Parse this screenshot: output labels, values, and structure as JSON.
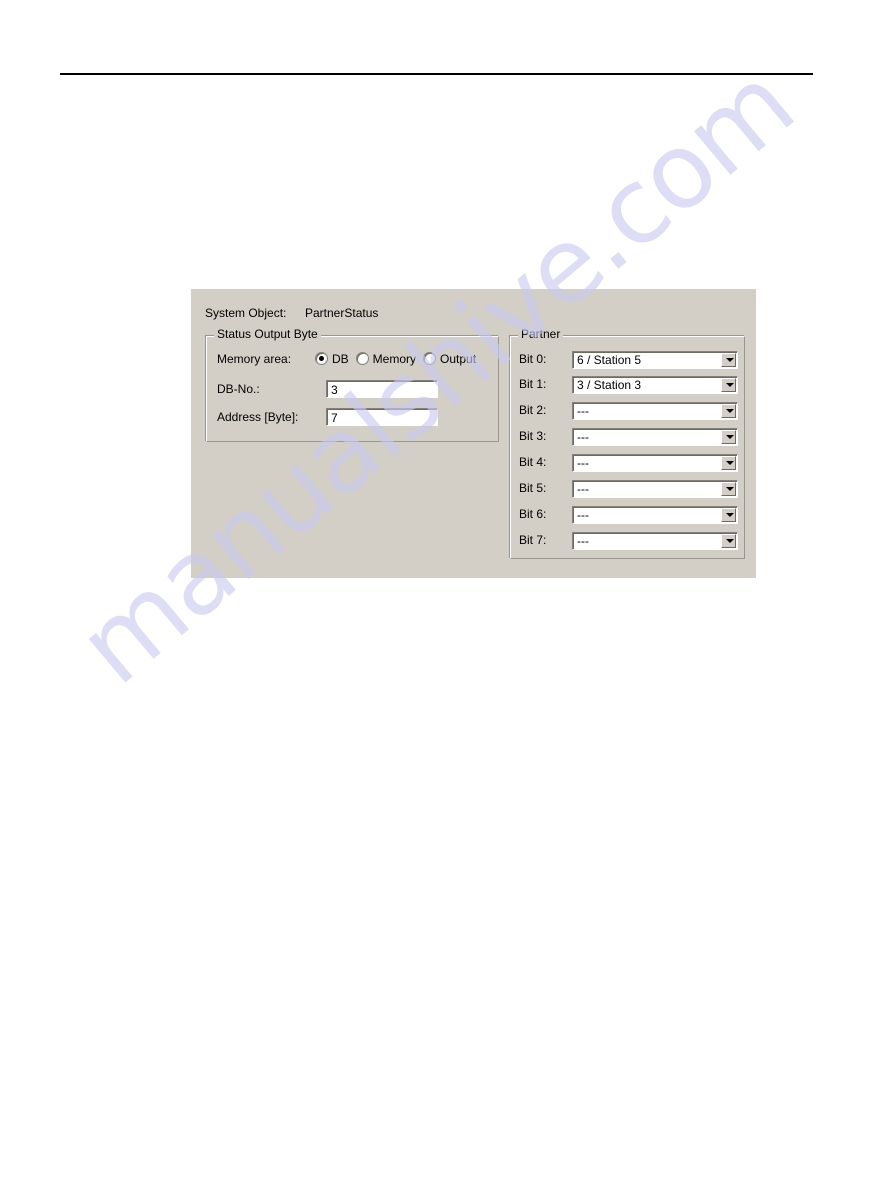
{
  "page": {
    "header_rule": "horizontal-rule",
    "watermark": "manualshive.com",
    "watermark_color": "#c9c9ef"
  },
  "dialog": {
    "background_color": "#d3cfc7",
    "system_object": {
      "label": "System Object:",
      "value": "PartnerStatus"
    },
    "status_output_byte": {
      "title": "Status Output Byte",
      "memory_area": {
        "label": "Memory area:",
        "options": [
          {
            "label": "DB",
            "checked": true
          },
          {
            "label": "Memory",
            "checked": false
          },
          {
            "label": "Output",
            "checked": false
          }
        ]
      },
      "fields": [
        {
          "label": "DB-No.:",
          "value": "3"
        },
        {
          "label": "Address [Byte]:",
          "value": "7"
        }
      ]
    },
    "partner": {
      "title": "Partner",
      "rows": [
        {
          "label": "Bit  0:",
          "value": "6 / Station 5"
        },
        {
          "label": "Bit  1:",
          "value": "3 / Station 3"
        },
        {
          "label": "Bit  2:",
          "value": "---"
        },
        {
          "label": "Bit  3:",
          "value": "---"
        },
        {
          "label": "Bit  4:",
          "value": "---"
        },
        {
          "label": "Bit  5:",
          "value": "---"
        },
        {
          "label": "Bit  6:",
          "value": "---"
        },
        {
          "label": "Bit  7:",
          "value": "---"
        }
      ]
    }
  }
}
